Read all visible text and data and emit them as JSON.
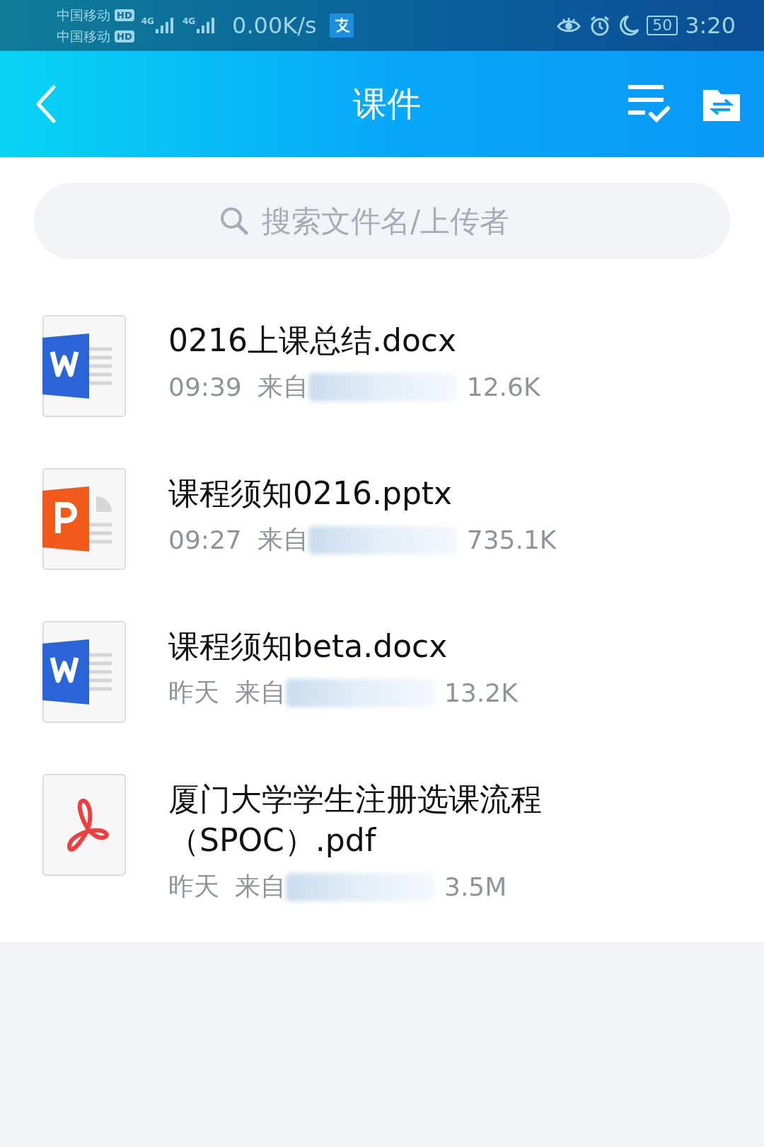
{
  "status_bar": {
    "carriers": [
      "中国移动",
      "中国移动"
    ],
    "hd_badges": [
      "HD",
      "HD"
    ],
    "network": [
      "4G",
      "4G"
    ],
    "speed": "0.00K/s",
    "battery": "50",
    "time": "3:20"
  },
  "header": {
    "title": "课件"
  },
  "search": {
    "placeholder": "搜索文件名/上传者"
  },
  "files": [
    {
      "kind": "word",
      "name": "0216上课总结.docx",
      "time": "09:39",
      "from": "来自",
      "size": "12.6K"
    },
    {
      "kind": "ppt",
      "name": "课程须知0216.pptx",
      "time": "09:27",
      "from": "来自",
      "size": "735.1K"
    },
    {
      "kind": "word",
      "name": "课程须知beta.docx",
      "time": "昨天",
      "from": "来自",
      "size": "13.2K"
    },
    {
      "kind": "pdf",
      "name": "厦门大学学生注册选课流程（SPOC）.pdf",
      "time": "昨天",
      "from": "来自",
      "size": "3.5M"
    }
  ]
}
